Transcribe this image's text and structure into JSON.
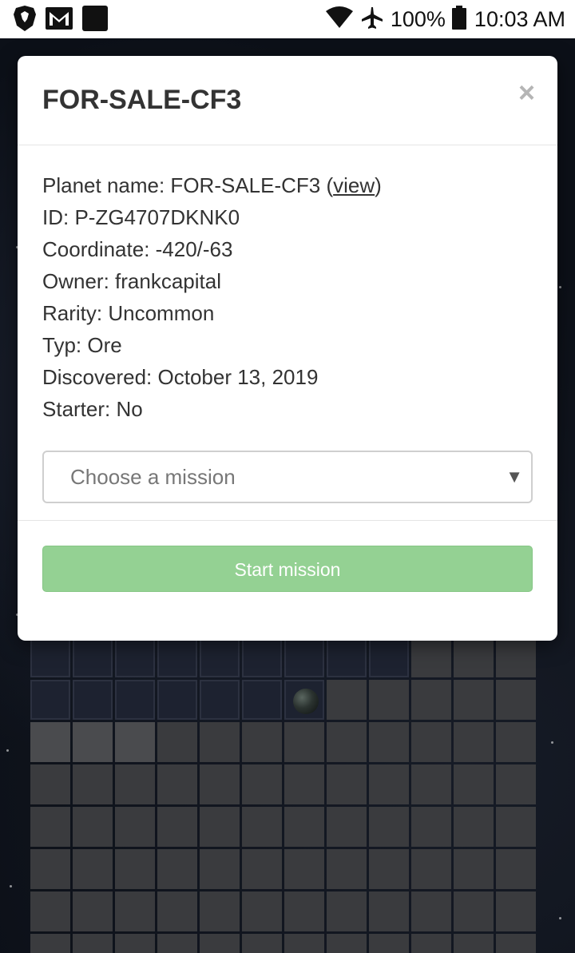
{
  "status_bar": {
    "battery_percent": "100%",
    "time": "10:03 AM",
    "icons": [
      "brave-icon",
      "gmail-icon",
      "app-icon",
      "wifi-icon",
      "airplane-icon",
      "battery-icon"
    ]
  },
  "modal": {
    "title": "FOR-SALE-CF3",
    "close_label": "×",
    "planet_name_label": "Planet name: FOR-SALE-CF3 (",
    "planet_view_link": "view",
    "planet_name_suffix": ")",
    "id": "ID: P-ZG4707DKNK0",
    "coordinate": "Coordinate: -420/-63",
    "owner": "Owner: frankcapital",
    "rarity": "Rarity: Uncommon",
    "type": "Typ: Ore",
    "discovered": "Discovered: October 13, 2019",
    "starter": "Starter: No",
    "mission_select": {
      "placeholder": "Choose a mission",
      "arrow": "▼"
    },
    "start_button": "Start mission"
  },
  "colors": {
    "start_button": "#94d193",
    "modal_bg": "#ffffff",
    "grid_cell": "#3a3b3e",
    "grid_cell_dark": "#1d2230",
    "space_bg": "#0c1018"
  }
}
